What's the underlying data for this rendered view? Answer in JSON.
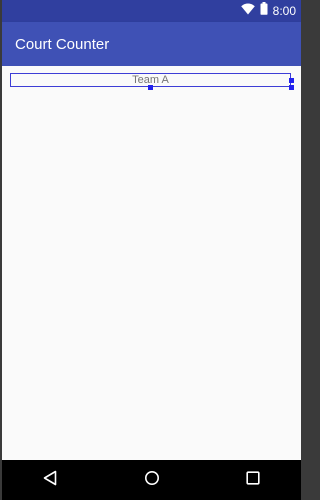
{
  "status_bar": {
    "time": "8:00",
    "icons": [
      "wifi-icon",
      "battery-icon"
    ],
    "color": "#303f9f"
  },
  "app_bar": {
    "title": "Court Counter",
    "color": "#3f51b5"
  },
  "content": {
    "team_label": "Team A",
    "selection_color": "#2222ee"
  },
  "nav_bar": {
    "buttons": [
      "back-icon",
      "home-icon",
      "recents-icon"
    ]
  }
}
